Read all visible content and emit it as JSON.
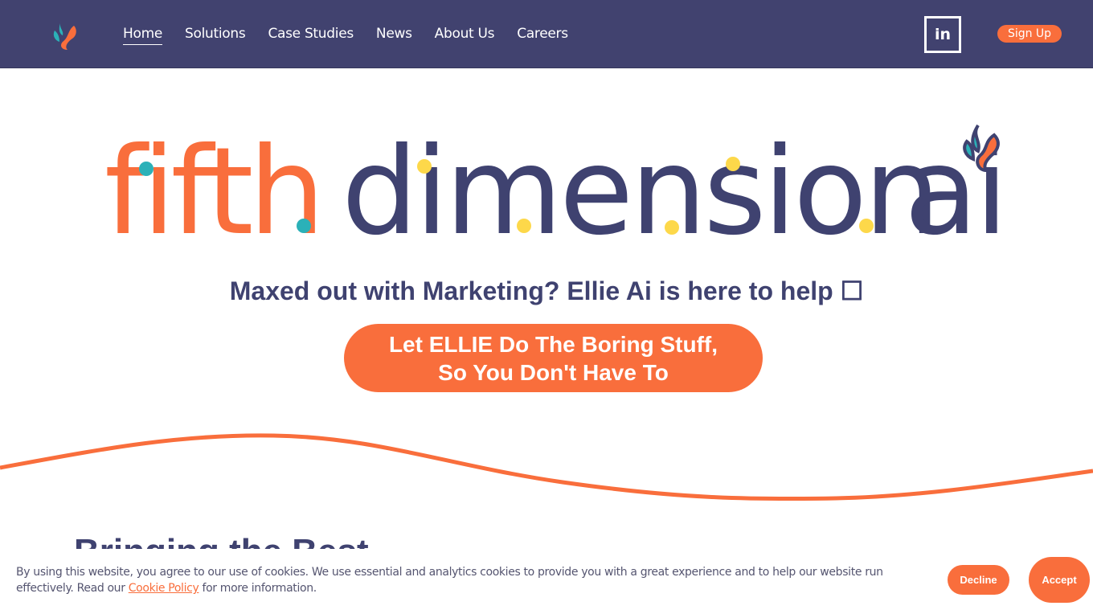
{
  "colors": {
    "nav_bg": "#41426f",
    "brand_orange": "#f96e3c",
    "brand_navy": "#3f4270",
    "brand_teal": "#2bb1b8",
    "brand_yellow": "#fdd84a"
  },
  "nav": {
    "logo_icon": "flame-leaf-logo-icon",
    "links": [
      {
        "label": "Home",
        "active": true
      },
      {
        "label": "Solutions"
      },
      {
        "label": "Case Studies"
      },
      {
        "label": "News"
      },
      {
        "label": "About Us"
      },
      {
        "label": "Careers"
      }
    ],
    "linkedin_label": "in",
    "linkedin_icon": "linkedin-icon",
    "signup_label": "Sign Up"
  },
  "hero": {
    "logo_word_1": "fifth",
    "logo_word_2": "dimension",
    "logo_word_3": "ai",
    "tagline": "Maxed out with Marketing? Ellie Ai is here to help ☐",
    "cta_label": "Let ELLIE Do The Boring Stuff, So You Don't Have To"
  },
  "section": {
    "heading_partial": "Bringing the Best"
  },
  "cookie_banner": {
    "text_before_link": "By using this website, you agree to our use of cookies. We use essential and analytics cookies to provide you with a great experience and to help our website run effectively. Read our ",
    "link_label": "Cookie Policy",
    "text_after_link": " for more information.",
    "decline_label": "Decline",
    "accept_label": "Accept"
  }
}
